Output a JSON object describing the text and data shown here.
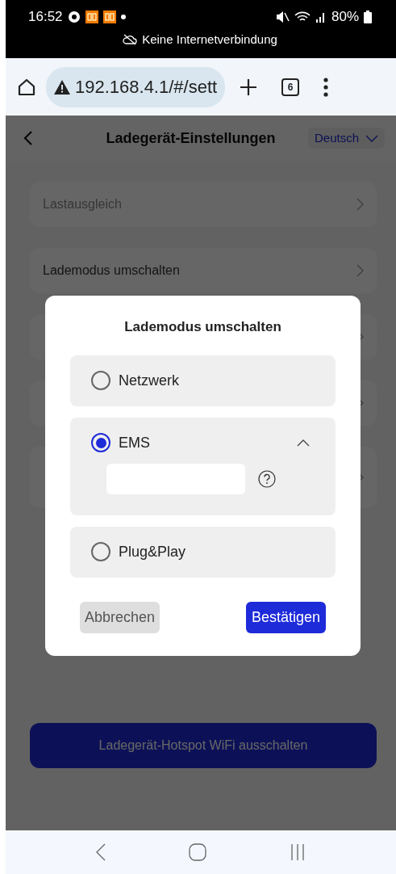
{
  "status_bar": {
    "time": "16:52",
    "battery": "80%",
    "notice": "Keine Internetverbindung"
  },
  "browser": {
    "url": "192.168.4.1/#/sett",
    "tab_count": "6"
  },
  "header": {
    "title": "Ladegerät-Einstellungen",
    "language": "Deutsch"
  },
  "settings_items": [
    {
      "label": "Lastausgleich",
      "disabled": true
    },
    {
      "label": "Lademodus umschalten",
      "disabled": false
    }
  ],
  "dialog": {
    "title": "Lademodus umschalten",
    "options": [
      {
        "label": "Netzwerk",
        "selected": false,
        "kind": "plain"
      },
      {
        "label": "EMS",
        "selected": true,
        "kind": "expandable",
        "expanded": true
      },
      {
        "label": "Plug&Play",
        "selected": false,
        "kind": "plain"
      }
    ],
    "cancel": "Abbrechen",
    "confirm": "Bestätigen"
  },
  "hotspot_button": "Ladegerät-Hotspot WiFi ausschalten"
}
